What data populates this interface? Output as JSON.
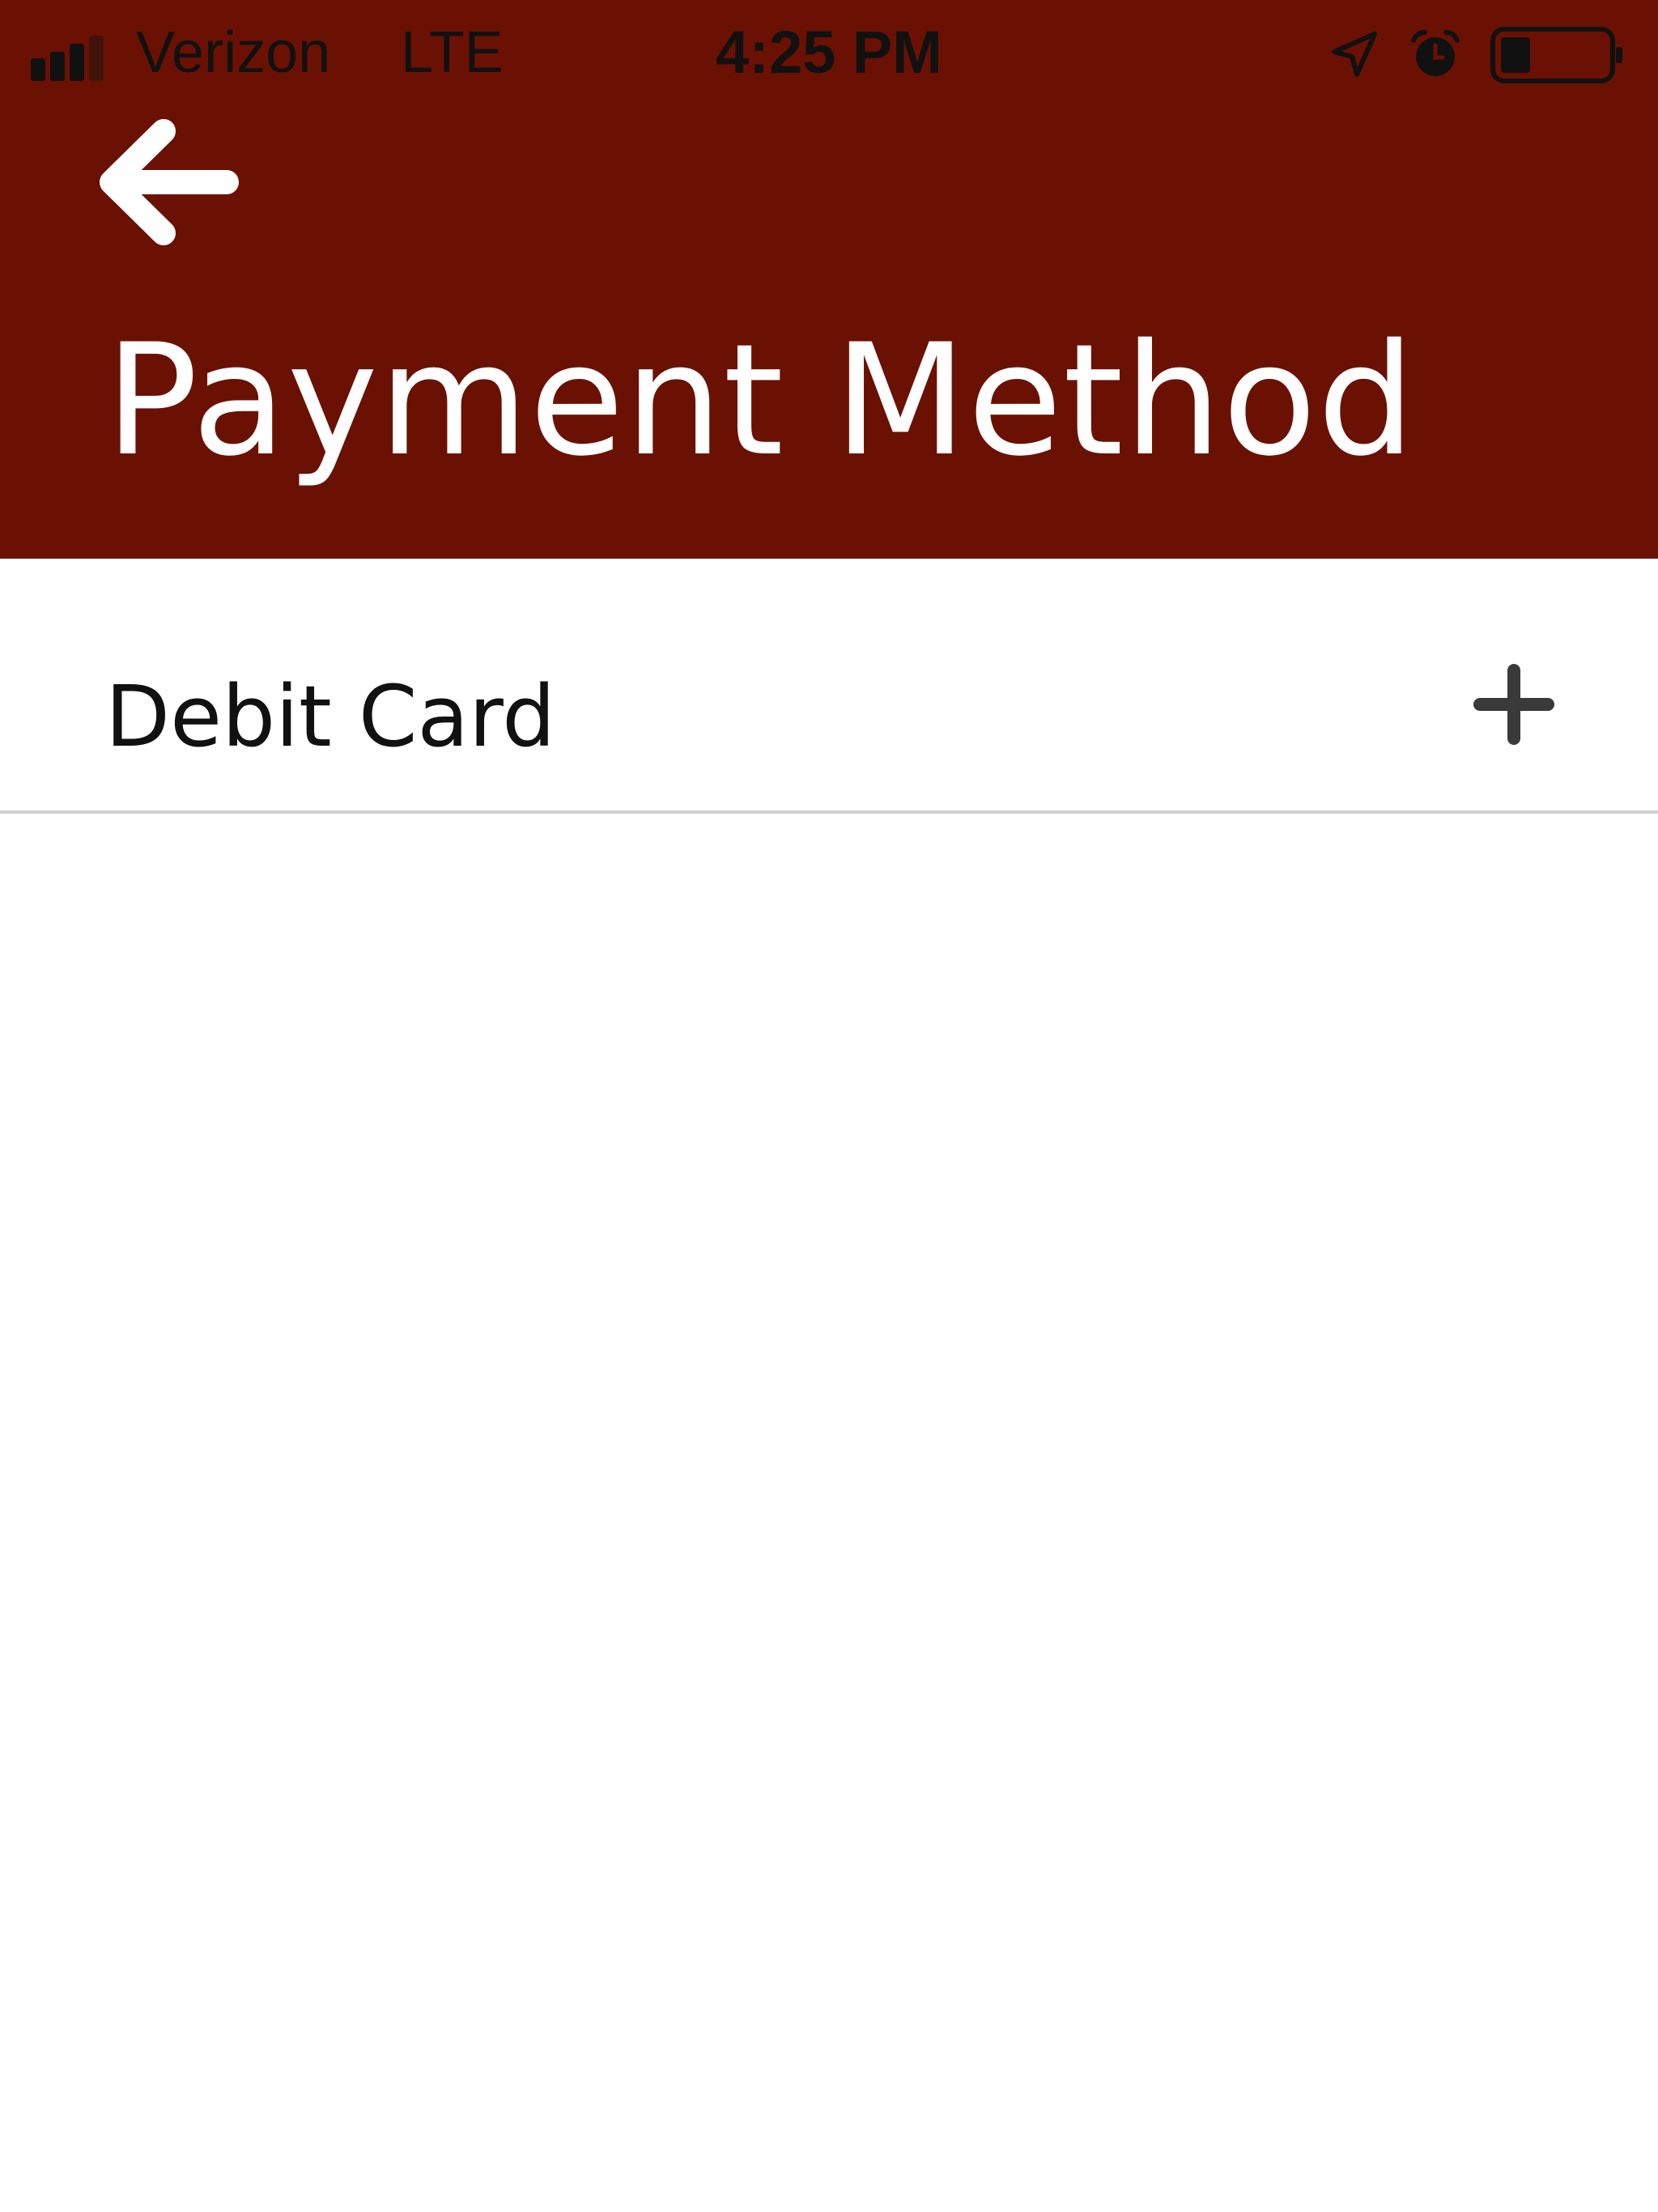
{
  "status_bar": {
    "carrier": "Verizon",
    "network": "LTE",
    "time": "4:25 PM",
    "icons": [
      "signal-bars",
      "location-arrow",
      "alarm-clock",
      "battery"
    ]
  },
  "header": {
    "back_icon": "arrow-left",
    "title": "Payment Method",
    "background_color": "#6b1104",
    "text_color": "#ffffff"
  },
  "list": {
    "items": [
      {
        "label": "Debit Card",
        "action_icon": "plus"
      }
    ]
  }
}
